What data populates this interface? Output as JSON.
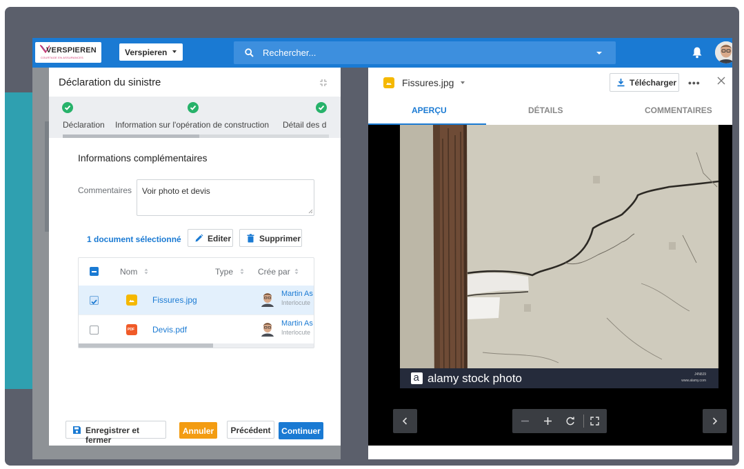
{
  "topbar": {
    "logo_text": "VERSPIEREN",
    "logo_subtitle": "COURTAGE EN ASSURANCES",
    "company_select": "Verspieren",
    "search_placeholder": "Rechercher...",
    "brand_color": "#1a7ad3"
  },
  "left_panel": {
    "title": "Déclaration du sinistre",
    "steps": [
      {
        "label": "Déclaration",
        "status": "done"
      },
      {
        "label": "Information sur l'opération de construction",
        "status": "done"
      },
      {
        "label": "Détail des d",
        "status": "done"
      }
    ],
    "section_title": "Informations complémentaires",
    "comments_label": "Commentaires",
    "comments_value": "Voir photo et devis",
    "selection_text": "1 document sélectionné",
    "edit_label": "Editer",
    "delete_label": "Supprimer",
    "table": {
      "columns": [
        "Nom",
        "Type",
        "Crée par"
      ],
      "rows": [
        {
          "file": "Fissures.jpg",
          "file_type": "image",
          "creator": "Martin As",
          "role": "Interlocute",
          "selected": true
        },
        {
          "file": "Devis.pdf",
          "file_type": "pdf",
          "creator": "Martin As",
          "role": "Interlocute",
          "selected": false
        }
      ]
    },
    "footer": {
      "save_label": "Enregistrer et fermer",
      "cancel_label": "Annuler",
      "previous_label": "Précédent",
      "continue_label": "Continuer"
    }
  },
  "right_panel": {
    "file_title": "Fissures.jpg",
    "download_label": "Télécharger",
    "more_label": "•••",
    "tabs": [
      "APERÇU",
      "DÉTAILS",
      "COMMENTAIRES"
    ],
    "active_tab": "APERÇU",
    "watermark_text": "alamy stock photo",
    "watermark_id": "J4N8J9",
    "watermark_url": "www.alamy.com",
    "pdf_badge": "PDF"
  },
  "colors": {
    "success": "#27b26a",
    "cancel": "#f39c12",
    "frame": "#5b5f6b"
  }
}
